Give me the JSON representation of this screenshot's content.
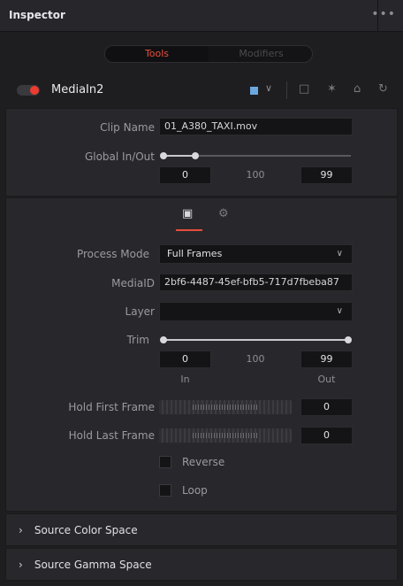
{
  "header": {
    "title": "Inspector",
    "more_icon": "•••"
  },
  "tabs": {
    "tools": "Tools",
    "modifiers": "Modifiers"
  },
  "node": {
    "name": "MediaIn2",
    "color_swatch": "#6aa8df",
    "icons": {
      "chevron": "∨",
      "version": "□",
      "pin": "✶",
      "lock": "⌂",
      "reset": "↻"
    }
  },
  "clip": {
    "clip_name_label": "Clip Name",
    "clip_name_value": "01_A380_TAXI.mov",
    "global_label": "Global In/Out",
    "global_in": "0",
    "global_mid": "100",
    "global_out": "99"
  },
  "subtabs": {
    "image_icon": "▣",
    "settings_icon": "⚙"
  },
  "process": {
    "process_mode_label": "Process Mode",
    "process_mode_value": "Full Frames",
    "media_id_label": "MediaID",
    "media_id_value": "2bf6-4487-45ef-bfb5-717d7fbeba87",
    "layer_label": "Layer",
    "layer_value": "",
    "trim_label": "Trim",
    "trim_in": "0",
    "trim_mid": "100",
    "trim_out": "99",
    "trim_in_caption": "In",
    "trim_out_caption": "Out",
    "hold_first_label": "Hold First Frame",
    "hold_first_value": "0",
    "hold_last_label": "Hold Last Frame",
    "hold_last_value": "0",
    "reverse_label": "Reverse",
    "loop_label": "Loop"
  },
  "sections": {
    "color_space": "Source Color Space",
    "gamma_space": "Source Gamma Space",
    "chevron": "›"
  },
  "colors": {
    "accent_red": "#ee3b30",
    "tab_active_text": "#e84d3d"
  }
}
